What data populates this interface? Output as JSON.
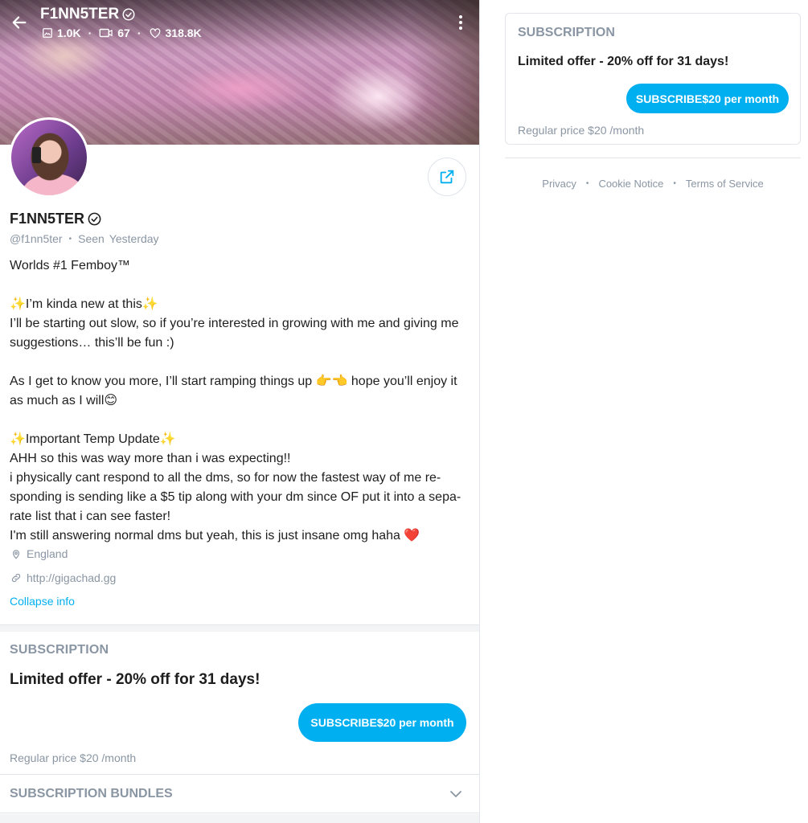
{
  "header": {
    "name": "F1NN5TER",
    "stats": {
      "photos": "1.0K",
      "videos": "67",
      "likes": "318.8K"
    },
    "icons": {
      "back": "arrow-left-icon",
      "verified": "verified-badge-icon",
      "more": "more-vertical-icon",
      "photos": "image-icon",
      "videos": "video-icon",
      "likes": "heart-icon"
    }
  },
  "profile": {
    "name": "F1NN5TER",
    "username": "@f1nn5ter",
    "seen_label": "Seen",
    "seen_value": "Yesterday",
    "bio": [
      "Worlds #1 Femboy™",
      "",
      "✨I’m kinda new at this✨",
      "I’ll be starting out slow, so if you’re interested in growing with me and giving me suggestions… this’ll be fun :)",
      "",
      "As I get to know you more, I’ll start ramping things up 👉👈 hope you’ll enjoy it as much as I will😊",
      "",
      "✨Important Temp Update✨",
      "AHH so this was way more than i was expecting!!",
      "i physically cant respond to all the dms, so for now the fastest way of me re-sponding is sending like a $5 tip along with your dm since OF put it into a sepa-rate list that i can see faster!",
      "I'm still answering normal dms but yeah, this is just insane omg haha ❤️"
    ],
    "location": "England",
    "website": "http://gigachad.gg",
    "collapse_label": "Collapse info"
  },
  "subscription": {
    "title": "SUBSCRIPTION",
    "offer": "Limited offer - 20% off for 31 days!",
    "button_label": "SUBSCRIBE$20 per month",
    "regular_price": "Regular price $20 /month",
    "bundles_label": "SUBSCRIPTION BUNDLES"
  },
  "footer": {
    "privacy": "Privacy",
    "cookie": "Cookie Notice",
    "terms": "Terms of Service"
  },
  "colors": {
    "accent": "#00aff0",
    "muted": "#8a96a3",
    "text": "#1e1e1e",
    "heart": "#e0233a"
  }
}
